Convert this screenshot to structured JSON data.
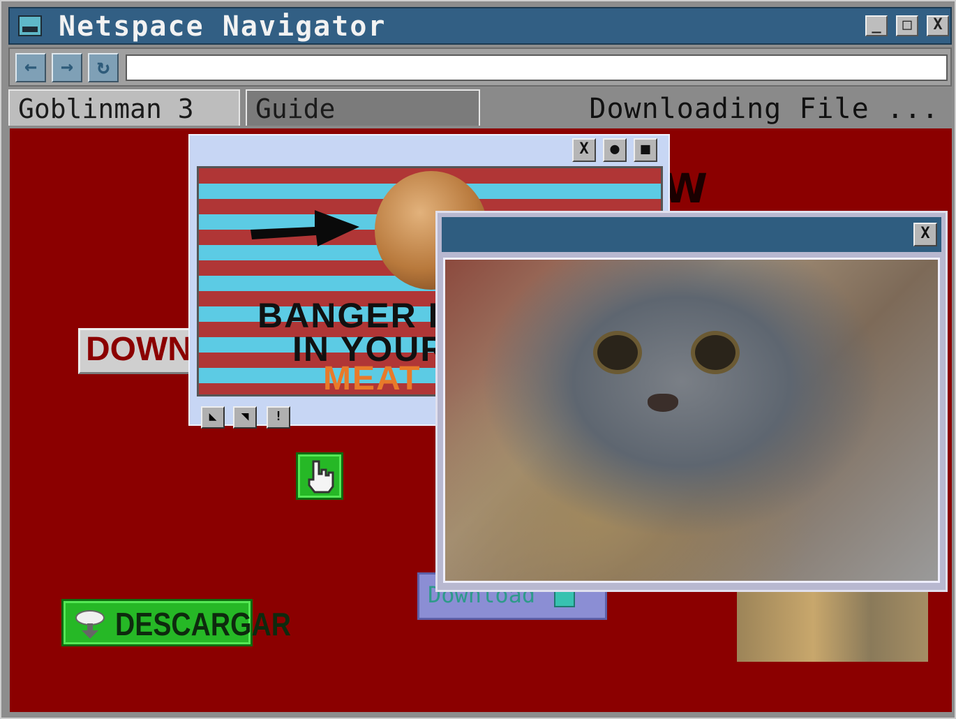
{
  "window": {
    "title": "Netspace Navigator",
    "controls": {
      "minimize": "_",
      "maximize": "□",
      "close": "X"
    }
  },
  "toolbar": {
    "back_label": "←",
    "forward_label": "→",
    "reload_label": "↻",
    "url_value": ""
  },
  "tabs": [
    {
      "label": "Goblinman 3"
    },
    {
      "label": "Guide"
    }
  ],
  "status_text": "Downloading File ...",
  "content": {
    "bg_text": "W",
    "download_red_label": "DOWNLOA",
    "descargar_label": "DESCARGAR",
    "download_purple_label": "Download",
    "ad_popup": {
      "controls": [
        "X",
        "●",
        "■"
      ],
      "line1": "BANGER B",
      "line2": "IN YOUR",
      "line3": "MEAT",
      "bottom_controls": [
        "◣",
        "◥",
        "!"
      ]
    },
    "cat_popup": {
      "close_label": "X"
    }
  },
  "colors": {
    "title_bar": "#325f84",
    "content_bg": "#8b0000",
    "green_button": "#26b826",
    "ad_stripe_red": "#b03636",
    "ad_stripe_blue": "#5ccbe4",
    "meat_text": "#e87a2a"
  }
}
